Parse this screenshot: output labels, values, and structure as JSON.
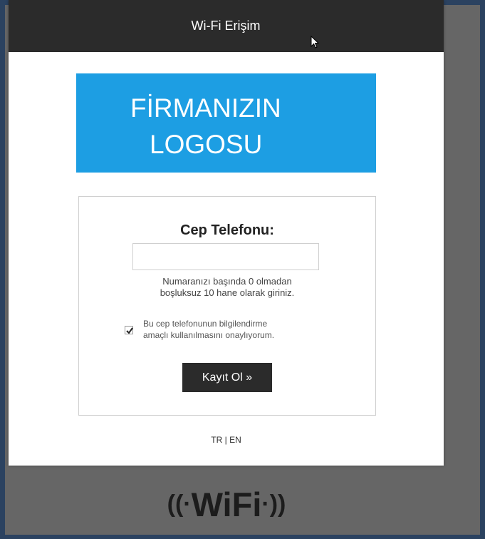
{
  "header": {
    "title": "Wi-Fi Erişim"
  },
  "logo": {
    "line1": "FİRMANIZIN",
    "line2": "LOGOSU",
    "color": "#1d9ee3"
  },
  "form": {
    "label": "Cep Telefonu:",
    "phone_value": "",
    "phone_placeholder": "",
    "help_line1": "Numaranızı başında 0 olmadan",
    "help_line2": "boşluksuz 10 hane olarak giriniz.",
    "consent_line1": "Bu cep telefonunun bilgilendirme",
    "consent_line2": "amaçlı kullanılmasını onaylıyorum.",
    "consent_checked": true,
    "submit_label": "Kayıt Ol »"
  },
  "language": {
    "tr": "TR",
    "separator": " | ",
    "en": "EN"
  },
  "footer_logo": {
    "left_waves": "((·",
    "text": "WiFi",
    "right_waves": "·))"
  },
  "colors": {
    "topbar": "#2b2b2b",
    "frame": "#2b4260",
    "button": "#2b2b2b"
  }
}
